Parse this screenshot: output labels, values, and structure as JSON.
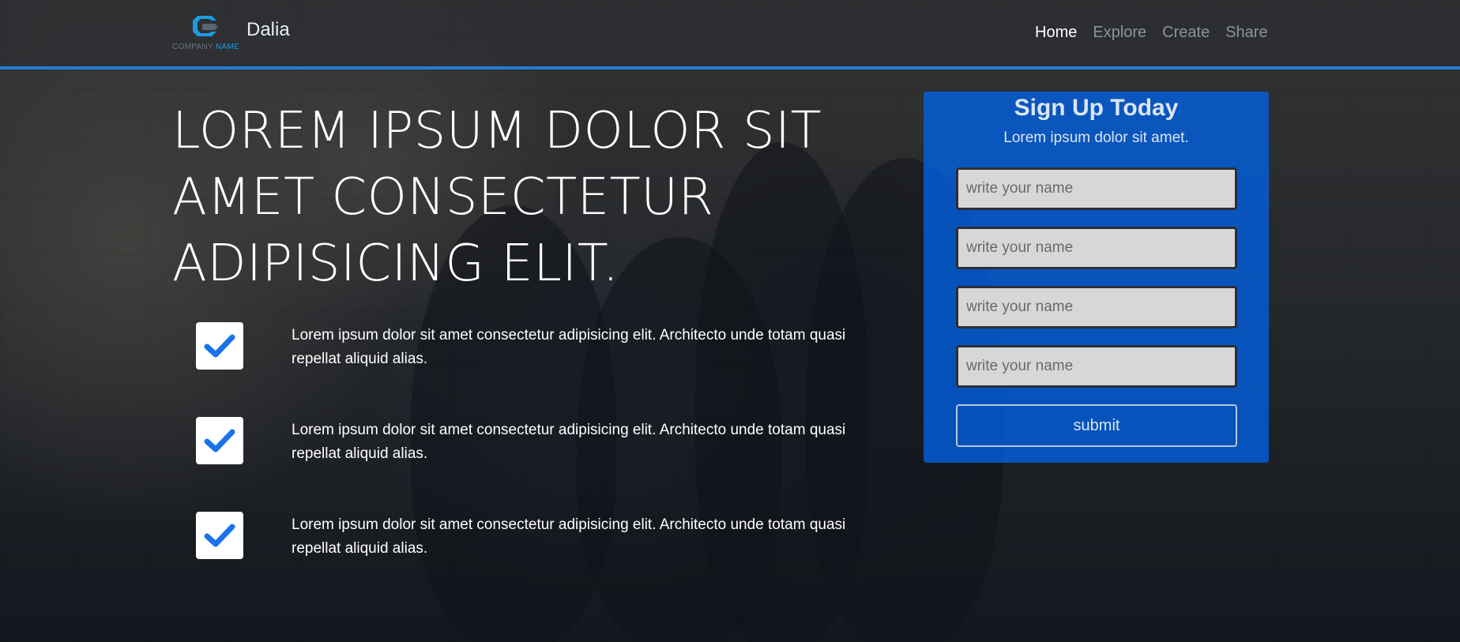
{
  "brand": {
    "name": "Dalia",
    "sub_company": "COMPANY ",
    "sub_name": "NAME"
  },
  "nav": {
    "items": [
      {
        "label": "Home",
        "active": true
      },
      {
        "label": "Explore",
        "active": false
      },
      {
        "label": "Create",
        "active": false
      },
      {
        "label": "Share",
        "active": false
      }
    ]
  },
  "hero": {
    "headline": "LOREM IPSUM DOLOR SIT AMET CONSECTETUR ADIPISICING ELIT."
  },
  "features": [
    {
      "text": "Lorem ipsum dolor sit amet consectetur adipisicing elit. Architecto unde totam quasi repellat aliquid alias.",
      "icon": "check-icon"
    },
    {
      "text": "Lorem ipsum dolor sit amet consectetur adipisicing elit. Architecto unde totam quasi repellat aliquid alias.",
      "icon": "check-icon"
    },
    {
      "text": "Lorem ipsum dolor sit amet consectetur adipisicing elit. Architecto unde totam quasi repellat aliquid alias.",
      "icon": "check-icon"
    }
  ],
  "signup": {
    "title": "Sign Up Today",
    "subtitle": "Lorem ipsum dolor sit amet.",
    "fields": [
      {
        "placeholder": "write your name",
        "value": ""
      },
      {
        "placeholder": "write your name",
        "value": ""
      },
      {
        "placeholder": "write your name",
        "value": ""
      },
      {
        "placeholder": "write your name",
        "value": ""
      }
    ],
    "submit_label": "submit"
  },
  "colors": {
    "accent": "#1e7fd6",
    "panel": "#0062e6",
    "check": "#1a73e8"
  }
}
